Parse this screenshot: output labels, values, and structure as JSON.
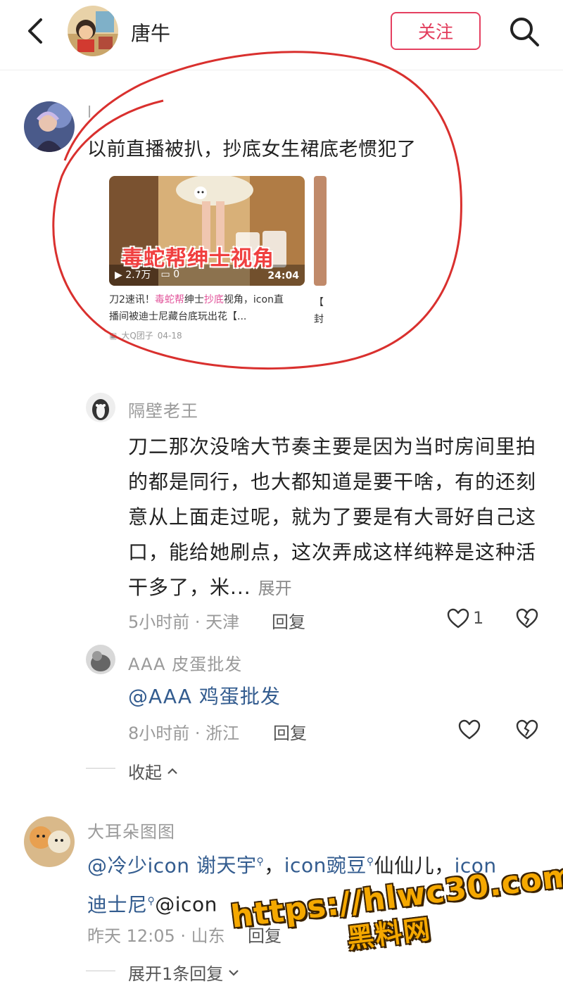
{
  "header": {
    "author_name": "唐牛",
    "follow_label": "关注"
  },
  "comment1": {
    "username": "l",
    "text": "以前直播被扒，抄底女生裙底老惯犯了",
    "video_card": {
      "overlay_title": "毒蛇帮绅士视角",
      "views": "2.7万",
      "danmaku": "0",
      "duration": "24:04",
      "desc_prefix": "刀2速讯！",
      "desc_hl1": "毒蛇帮",
      "desc_mid1": "绅士",
      "desc_hl2": "抄底",
      "desc_mid2": "视角，icon直播间被迪士尼藏台底玩出花【...",
      "uploader": "大Q团子",
      "date": "04-18"
    },
    "partial_card_text": "【雪 封"
  },
  "reply1": {
    "username": "隔壁老王",
    "text": "刀二那次没啥大节奏主要是因为当时房间里拍的都是同行，也大都知道是要干啥，有的还刻意从上面走过呢，就为了要是有大哥好自己这口，能给她刷点，这次弄成这样纯粹是这种活干多了，米...",
    "expand_label": "展开",
    "time_location": "5小时前 · 天津",
    "reply_label": "回复",
    "like_count": "1"
  },
  "reply2": {
    "username": "AAA 皮蛋批发",
    "text": "@AAA 鸡蛋批发",
    "time_location": "8小时前 · 浙江",
    "reply_label": "回复"
  },
  "collapse_label": "收起",
  "comment2": {
    "username": "大耳朵图图",
    "m1": "@冷少icon",
    "m2": "谢天宇",
    "sep1": "，",
    "m3": "icon豌豆",
    "plain1": "仙仙儿，",
    "m4": "icon",
    "m5": "迪士尼",
    "plain2": "@icon",
    "time_location": "昨天 12:05 · 山东",
    "reply_label": "回复"
  },
  "expand_replies_label": "展开1条回复",
  "watermark": {
    "url": "https://hlwc30.com",
    "name": "黑料网"
  },
  "colors": {
    "accent": "#e54060",
    "mention": "#335c8f",
    "circle": "#d9302e",
    "watermark": "#f5a800"
  }
}
